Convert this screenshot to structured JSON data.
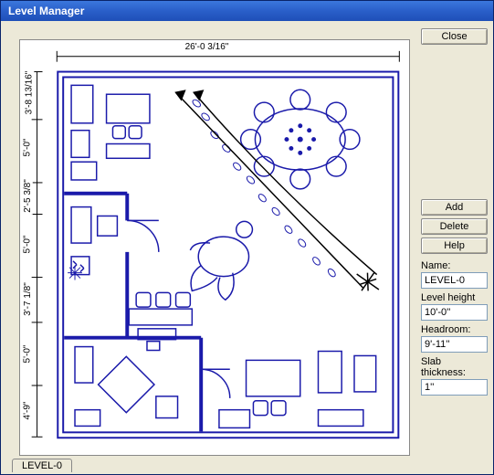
{
  "window": {
    "title": "Level Manager"
  },
  "buttons": {
    "close": "Close",
    "add": "Add",
    "delete": "Delete",
    "help": "Help"
  },
  "fields": {
    "name_label": "Name:",
    "name_value": "LEVEL-0",
    "level_height_label": "Level height",
    "level_height_value": "10'-0''",
    "headroom_label": "Headroom:",
    "headroom_value": "9'-11''",
    "slab_label": "Slab thickness:",
    "slab_value": "1''"
  },
  "tab": {
    "label": "LEVEL-0"
  },
  "dimensions": {
    "top": "26'-0 3/16\"",
    "left_1": "3'-8 13/16\"",
    "left_2": "5'-0\"",
    "left_3": "2'-5 3/8\"",
    "left_4": "5'-0\"",
    "left_5": "3'-7 1/8\"",
    "left_6": "5'-0\"",
    "left_7": "4'-9\""
  }
}
